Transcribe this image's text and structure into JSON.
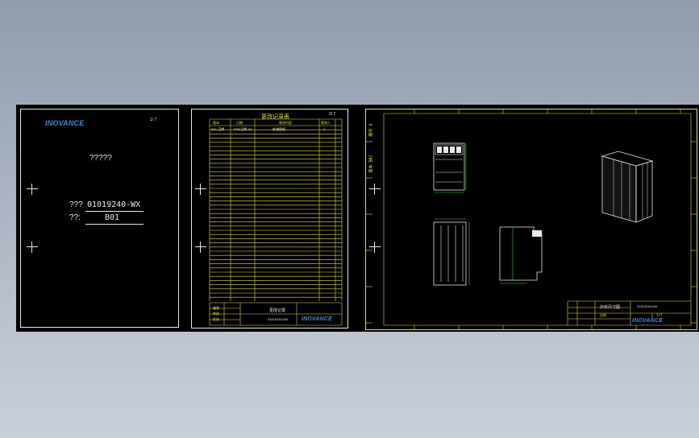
{
  "colors": {
    "background_top": "#8e9cad",
    "canvas": "#000000",
    "sheet_border": "#e8e8e8",
    "table_lines": "#e6e600",
    "brand": "#2f8ee8",
    "drawing_lines": "#e8e8e8",
    "dimension_lines": "#22dd22"
  },
  "cover_sheet": {
    "brand": "INOVANCE",
    "page_marks": "1/  7",
    "title": "?????",
    "code_label": "???",
    "code_value": "01019240-WX",
    "version_label": "??:",
    "version_value": "B01"
  },
  "record_sheet": {
    "title": "更改记录表",
    "page_marks": "2/  7",
    "header_cols": [
      "版本",
      "日期",
      "更改内容",
      "更改人"
    ],
    "row1": [
      "B01 日期",
      "FRN日期 N0",
      "新增图纸",
      "A"
    ],
    "footer_labels": [
      "编制",
      "审核",
      "批准"
    ],
    "footer_title": "更改记录",
    "footer_code": "01019240-WX",
    "brand": "INOVANCE"
  },
  "drawing_sheet": {
    "side_text_top": "图号 A",
    "side_text_mid": "版本 B01",
    "title_block_name": "外形尺寸图",
    "title_block_code": "01019240-WX",
    "title_block_scale": "比例",
    "title_block_sheet": "7/7",
    "brand": "INOVANCE",
    "icon_names": [
      "front-view-icon",
      "isometric-view-icon",
      "side-front-view-icon",
      "side-view-icon"
    ]
  }
}
